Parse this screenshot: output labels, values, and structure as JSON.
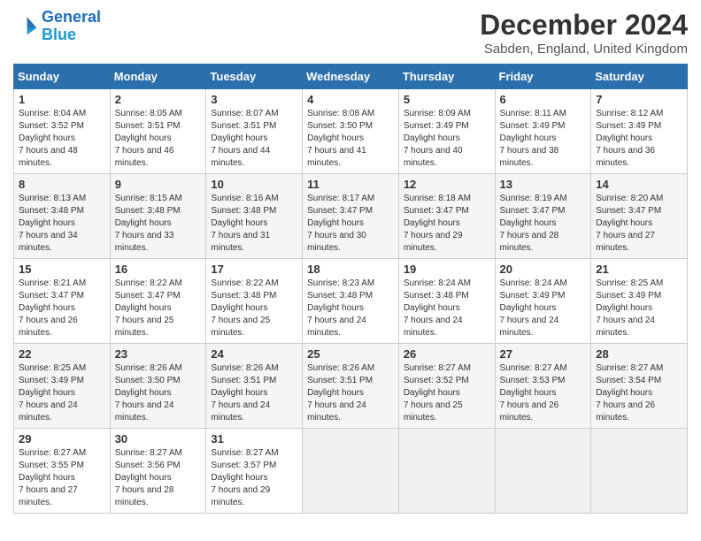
{
  "logo": {
    "line1": "General",
    "line2": "Blue"
  },
  "title": "December 2024",
  "location": "Sabden, England, United Kingdom",
  "days_of_week": [
    "Sunday",
    "Monday",
    "Tuesday",
    "Wednesday",
    "Thursday",
    "Friday",
    "Saturday"
  ],
  "weeks": [
    [
      {
        "day": "1",
        "sunrise": "8:04 AM",
        "sunset": "3:52 PM",
        "daylight": "7 hours and 48 minutes."
      },
      {
        "day": "2",
        "sunrise": "8:05 AM",
        "sunset": "3:51 PM",
        "daylight": "7 hours and 46 minutes."
      },
      {
        "day": "3",
        "sunrise": "8:07 AM",
        "sunset": "3:51 PM",
        "daylight": "7 hours and 44 minutes."
      },
      {
        "day": "4",
        "sunrise": "8:08 AM",
        "sunset": "3:50 PM",
        "daylight": "7 hours and 41 minutes."
      },
      {
        "day": "5",
        "sunrise": "8:09 AM",
        "sunset": "3:49 PM",
        "daylight": "7 hours and 40 minutes."
      },
      {
        "day": "6",
        "sunrise": "8:11 AM",
        "sunset": "3:49 PM",
        "daylight": "7 hours and 38 minutes."
      },
      {
        "day": "7",
        "sunrise": "8:12 AM",
        "sunset": "3:49 PM",
        "daylight": "7 hours and 36 minutes."
      }
    ],
    [
      {
        "day": "8",
        "sunrise": "8:13 AM",
        "sunset": "3:48 PM",
        "daylight": "7 hours and 34 minutes."
      },
      {
        "day": "9",
        "sunrise": "8:15 AM",
        "sunset": "3:48 PM",
        "daylight": "7 hours and 33 minutes."
      },
      {
        "day": "10",
        "sunrise": "8:16 AM",
        "sunset": "3:48 PM",
        "daylight": "7 hours and 31 minutes."
      },
      {
        "day": "11",
        "sunrise": "8:17 AM",
        "sunset": "3:47 PM",
        "daylight": "7 hours and 30 minutes."
      },
      {
        "day": "12",
        "sunrise": "8:18 AM",
        "sunset": "3:47 PM",
        "daylight": "7 hours and 29 minutes."
      },
      {
        "day": "13",
        "sunrise": "8:19 AM",
        "sunset": "3:47 PM",
        "daylight": "7 hours and 28 minutes."
      },
      {
        "day": "14",
        "sunrise": "8:20 AM",
        "sunset": "3:47 PM",
        "daylight": "7 hours and 27 minutes."
      }
    ],
    [
      {
        "day": "15",
        "sunrise": "8:21 AM",
        "sunset": "3:47 PM",
        "daylight": "7 hours and 26 minutes."
      },
      {
        "day": "16",
        "sunrise": "8:22 AM",
        "sunset": "3:47 PM",
        "daylight": "7 hours and 25 minutes."
      },
      {
        "day": "17",
        "sunrise": "8:22 AM",
        "sunset": "3:48 PM",
        "daylight": "7 hours and 25 minutes."
      },
      {
        "day": "18",
        "sunrise": "8:23 AM",
        "sunset": "3:48 PM",
        "daylight": "7 hours and 24 minutes."
      },
      {
        "day": "19",
        "sunrise": "8:24 AM",
        "sunset": "3:48 PM",
        "daylight": "7 hours and 24 minutes."
      },
      {
        "day": "20",
        "sunrise": "8:24 AM",
        "sunset": "3:49 PM",
        "daylight": "7 hours and 24 minutes."
      },
      {
        "day": "21",
        "sunrise": "8:25 AM",
        "sunset": "3:49 PM",
        "daylight": "7 hours and 24 minutes."
      }
    ],
    [
      {
        "day": "22",
        "sunrise": "8:25 AM",
        "sunset": "3:49 PM",
        "daylight": "7 hours and 24 minutes."
      },
      {
        "day": "23",
        "sunrise": "8:26 AM",
        "sunset": "3:50 PM",
        "daylight": "7 hours and 24 minutes."
      },
      {
        "day": "24",
        "sunrise": "8:26 AM",
        "sunset": "3:51 PM",
        "daylight": "7 hours and 24 minutes."
      },
      {
        "day": "25",
        "sunrise": "8:26 AM",
        "sunset": "3:51 PM",
        "daylight": "7 hours and 24 minutes."
      },
      {
        "day": "26",
        "sunrise": "8:27 AM",
        "sunset": "3:52 PM",
        "daylight": "7 hours and 25 minutes."
      },
      {
        "day": "27",
        "sunrise": "8:27 AM",
        "sunset": "3:53 PM",
        "daylight": "7 hours and 26 minutes."
      },
      {
        "day": "28",
        "sunrise": "8:27 AM",
        "sunset": "3:54 PM",
        "daylight": "7 hours and 26 minutes."
      }
    ],
    [
      {
        "day": "29",
        "sunrise": "8:27 AM",
        "sunset": "3:55 PM",
        "daylight": "7 hours and 27 minutes."
      },
      {
        "day": "30",
        "sunrise": "8:27 AM",
        "sunset": "3:56 PM",
        "daylight": "7 hours and 28 minutes."
      },
      {
        "day": "31",
        "sunrise": "8:27 AM",
        "sunset": "3:57 PM",
        "daylight": "7 hours and 29 minutes."
      },
      null,
      null,
      null,
      null
    ]
  ]
}
